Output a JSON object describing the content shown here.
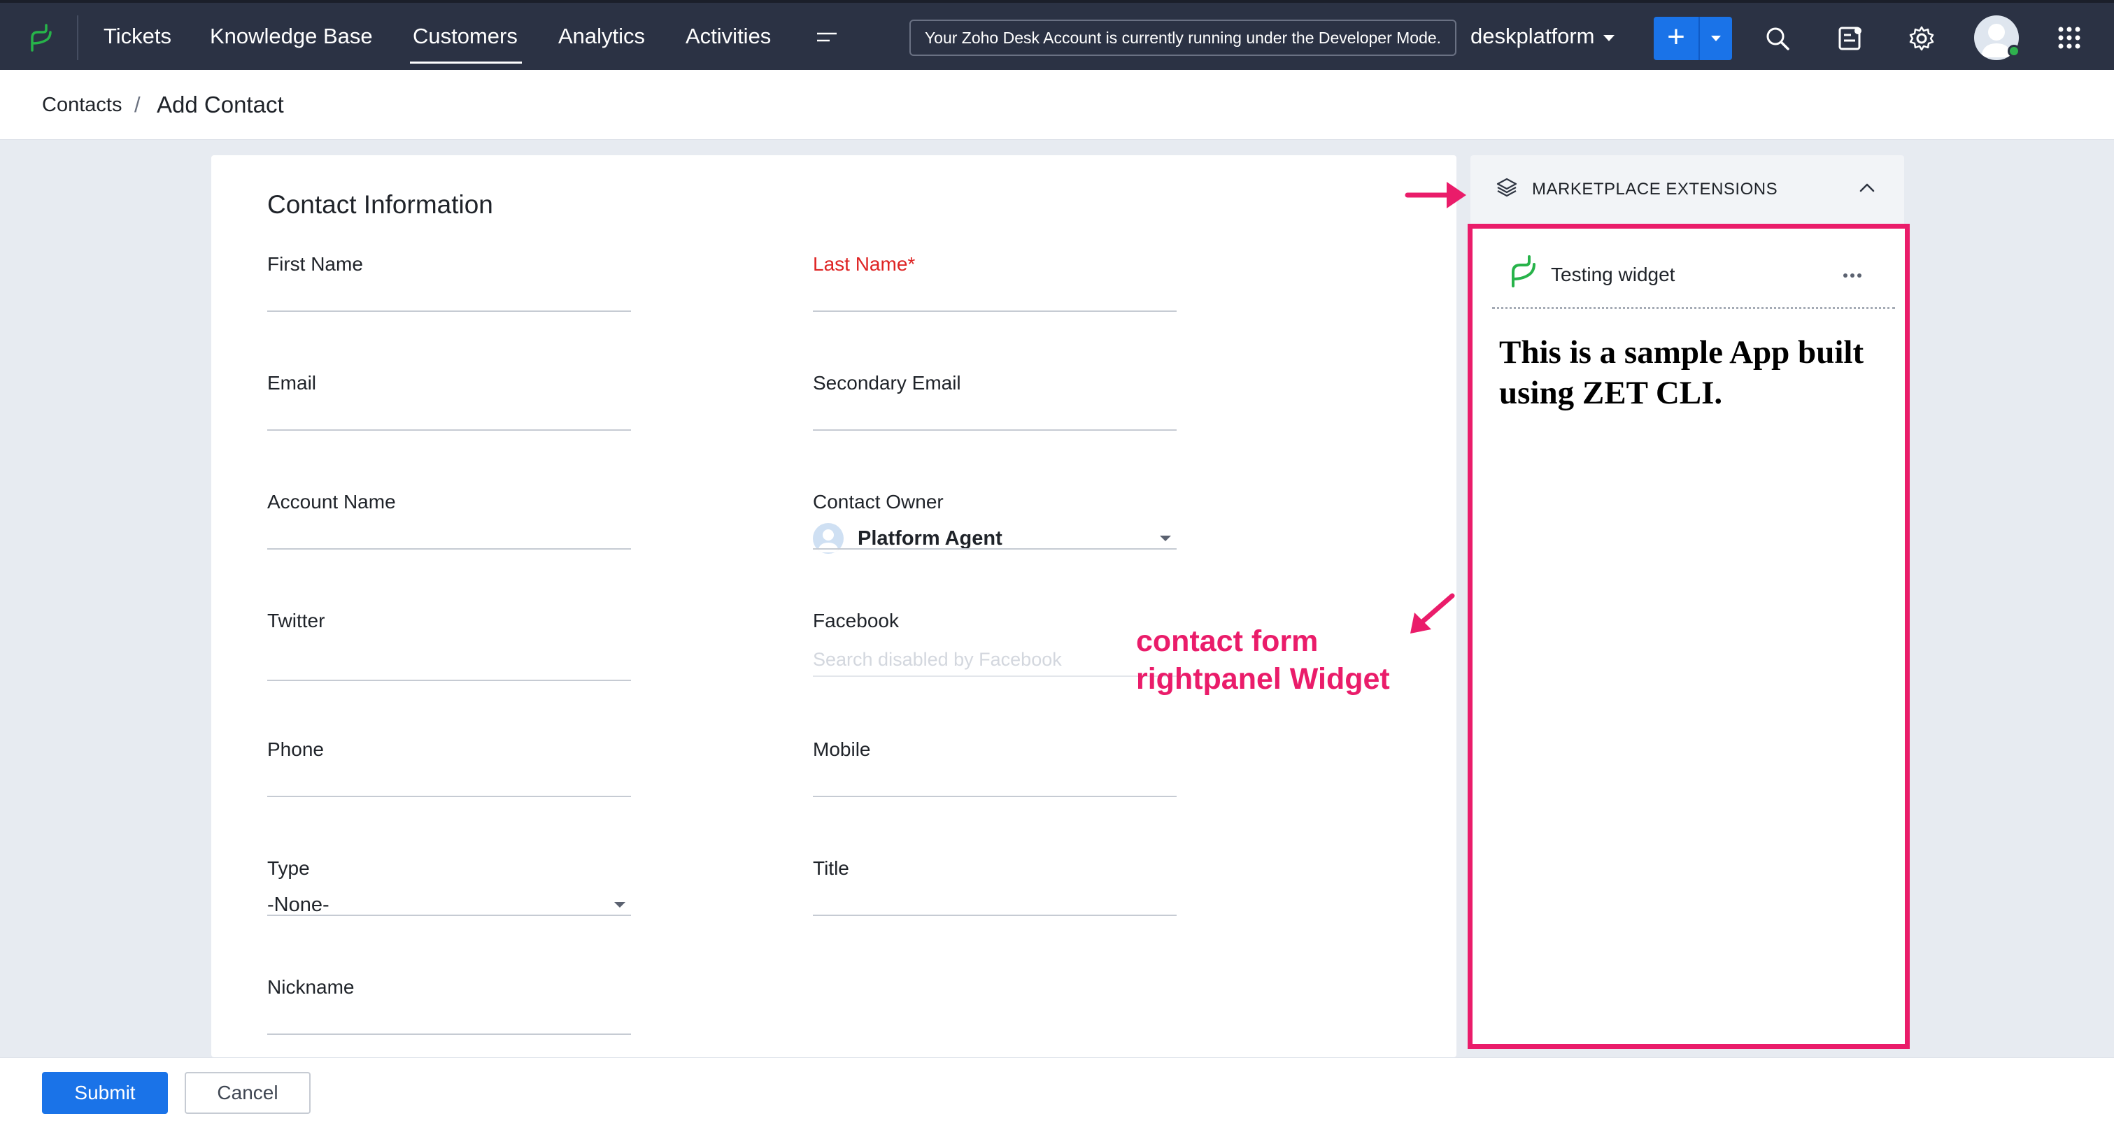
{
  "nav": {
    "items": [
      {
        "label": "Tickets",
        "active": false
      },
      {
        "label": "Knowledge Base",
        "active": false
      },
      {
        "label": "Customers",
        "active": true
      },
      {
        "label": "Analytics",
        "active": false
      },
      {
        "label": "Activities",
        "active": false
      }
    ],
    "dev_banner": "Your Zoho Desk Account is currently running under the Developer Mode.",
    "org_name": "deskplatform",
    "icons": [
      "menu-more-icon",
      "plus-icon",
      "search-icon",
      "notes-icon",
      "gear-icon",
      "avatar",
      "apps-grid-icon"
    ]
  },
  "breadcrumb": {
    "parent": "Contacts",
    "separator": "/",
    "current": "Add Contact"
  },
  "form": {
    "section_title": "Contact Information",
    "fields": {
      "first_name": {
        "label": "First Name",
        "value": ""
      },
      "last_name": {
        "label": "Last Name",
        "required_mark": "*",
        "value": ""
      },
      "email": {
        "label": "Email",
        "value": ""
      },
      "secondary_email": {
        "label": "Secondary Email",
        "value": ""
      },
      "account_name": {
        "label": "Account Name",
        "value": ""
      },
      "contact_owner": {
        "label": "Contact Owner",
        "value": "Platform Agent"
      },
      "twitter": {
        "label": "Twitter",
        "value": ""
      },
      "facebook": {
        "label": "Facebook",
        "placeholder": "Search disabled by Facebook"
      },
      "phone": {
        "label": "Phone",
        "value": ""
      },
      "mobile": {
        "label": "Mobile",
        "value": ""
      },
      "type": {
        "label": "Type",
        "value": "-None-"
      },
      "title": {
        "label": "Title",
        "value": ""
      },
      "nickname": {
        "label": "Nickname",
        "value": ""
      }
    }
  },
  "annotation": {
    "line1": "contact form",
    "line2": "rightpanel Widget",
    "color": "#ea1c6a"
  },
  "right_panel": {
    "header": "MARKETPLACE EXTENSIONS",
    "widget": {
      "title": "Testing widget",
      "content": "This is a sample App built using ZET CLI."
    }
  },
  "footer": {
    "submit_label": "Submit",
    "cancel_label": "Cancel"
  },
  "colors": {
    "topbar": "#2b3244",
    "primary": "#1a73e8",
    "required": "#de2424",
    "annotation": "#ea1c6a",
    "brand_green": "#2fb14e"
  }
}
